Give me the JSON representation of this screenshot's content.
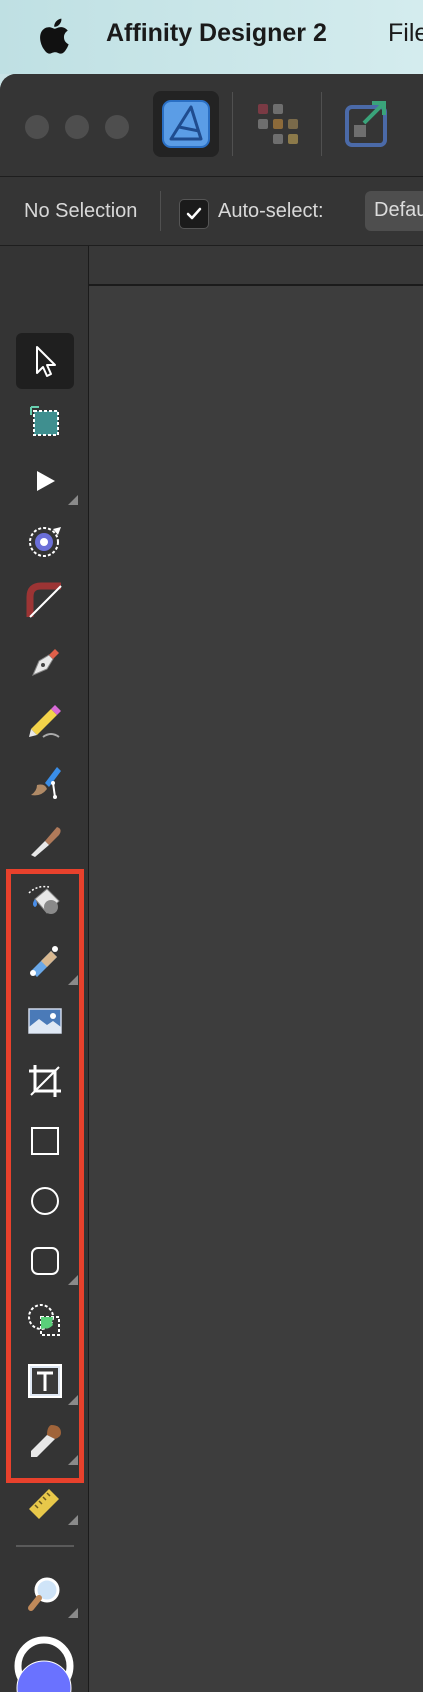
{
  "menubar": {
    "app_name": "Affinity Designer 2",
    "menu_file": "File"
  },
  "context_toolbar": {
    "selection_status": "No Selection",
    "auto_select_label": "Auto-select:",
    "auto_select_checked": true,
    "auto_select_mode": "Default"
  },
  "personas": [
    {
      "name": "designer-persona",
      "active": true
    },
    {
      "name": "pixel-persona",
      "active": false
    },
    {
      "name": "export-persona",
      "active": false
    }
  ],
  "tools": [
    {
      "icon": "move-tool-icon",
      "active": true
    },
    {
      "icon": "artboard-tool-icon"
    },
    {
      "icon": "node-tool-icon",
      "has_flyout": true
    },
    {
      "icon": "point-transform-tool-icon"
    },
    {
      "icon": "corner-tool-icon"
    },
    {
      "icon": "pen-tool-icon"
    },
    {
      "icon": "pencil-tool-icon"
    },
    {
      "icon": "vector-brush-tool-icon"
    },
    {
      "icon": "knife-tool-icon"
    },
    {
      "icon": "fill-tool-icon",
      "highlighted": true
    },
    {
      "icon": "transparency-tool-icon",
      "has_flyout": true,
      "highlighted": true
    },
    {
      "icon": "place-image-tool-icon",
      "highlighted": true
    },
    {
      "icon": "crop-tool-icon",
      "highlighted": true
    },
    {
      "icon": "rectangle-tool-icon",
      "highlighted": true
    },
    {
      "icon": "ellipse-tool-icon",
      "highlighted": true
    },
    {
      "icon": "rounded-rectangle-tool-icon",
      "has_flyout": true,
      "highlighted": true
    },
    {
      "icon": "shape-builder-tool-icon",
      "highlighted": true
    },
    {
      "icon": "artistic-text-tool-icon",
      "has_flyout": true,
      "highlighted": true
    },
    {
      "icon": "color-picker-tool-icon",
      "has_flyout": true,
      "highlighted": true
    },
    {
      "icon": "measure-tool-icon",
      "has_flyout": true
    },
    {
      "icon": "zoom-tool-icon",
      "has_flyout": true
    }
  ],
  "colors": {
    "highlight_border": "#e8412c",
    "primary_fill": "#6a72ff",
    "secondary_stroke": "#ffffff"
  }
}
